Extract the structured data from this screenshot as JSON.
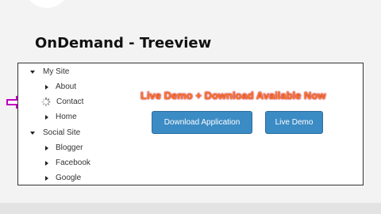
{
  "page": {
    "title": "OnDemand - Treeview"
  },
  "tree": {
    "nodes": [
      {
        "label": "My Site",
        "state": "expanded"
      },
      {
        "label": "About",
        "state": "collapsed"
      },
      {
        "label": "Contact",
        "state": "loading"
      },
      {
        "label": "Home",
        "state": "collapsed"
      },
      {
        "label": "Social Site",
        "state": "expanded"
      },
      {
        "label": "Blogger",
        "state": "collapsed"
      },
      {
        "label": "Facebook",
        "state": "collapsed"
      },
      {
        "label": "Google",
        "state": "collapsed"
      }
    ]
  },
  "promo": {
    "text": "Live Demo + Download Available Now"
  },
  "buttons": {
    "download_label": "Download Application",
    "live_demo_label": "Live Demo"
  },
  "colors": {
    "button_bg": "#3b8bc4",
    "promo_text": "#ff7a1f",
    "pointer_arrow": "#c000c0"
  }
}
